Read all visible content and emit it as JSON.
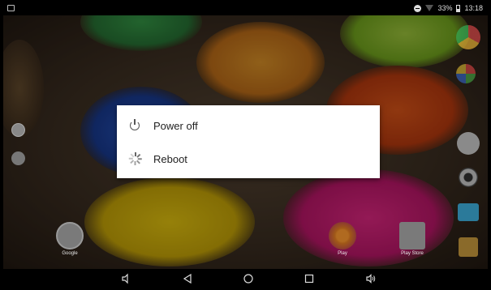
{
  "status_bar": {
    "battery_text": "33%",
    "time": "13:18"
  },
  "dialog": {
    "items": [
      {
        "label": "Power off",
        "icon": "power-icon"
      },
      {
        "label": "Reboot",
        "icon": "reboot-icon"
      }
    ]
  },
  "home": {
    "apps": [
      {
        "label": "Google",
        "icon": "google-app-icon"
      },
      {
        "label": "Play",
        "icon": "play-music-icon"
      },
      {
        "label": "Play Store",
        "icon": "play-store-icon"
      }
    ]
  },
  "nav_bar": {
    "buttons": [
      "volume-down-icon",
      "back-icon",
      "home-icon",
      "recents-icon",
      "volume-up-icon"
    ]
  },
  "colors": {
    "dialog_bg": "#ffffff",
    "dialog_text": "#222222",
    "bar_bg": "#000000"
  }
}
